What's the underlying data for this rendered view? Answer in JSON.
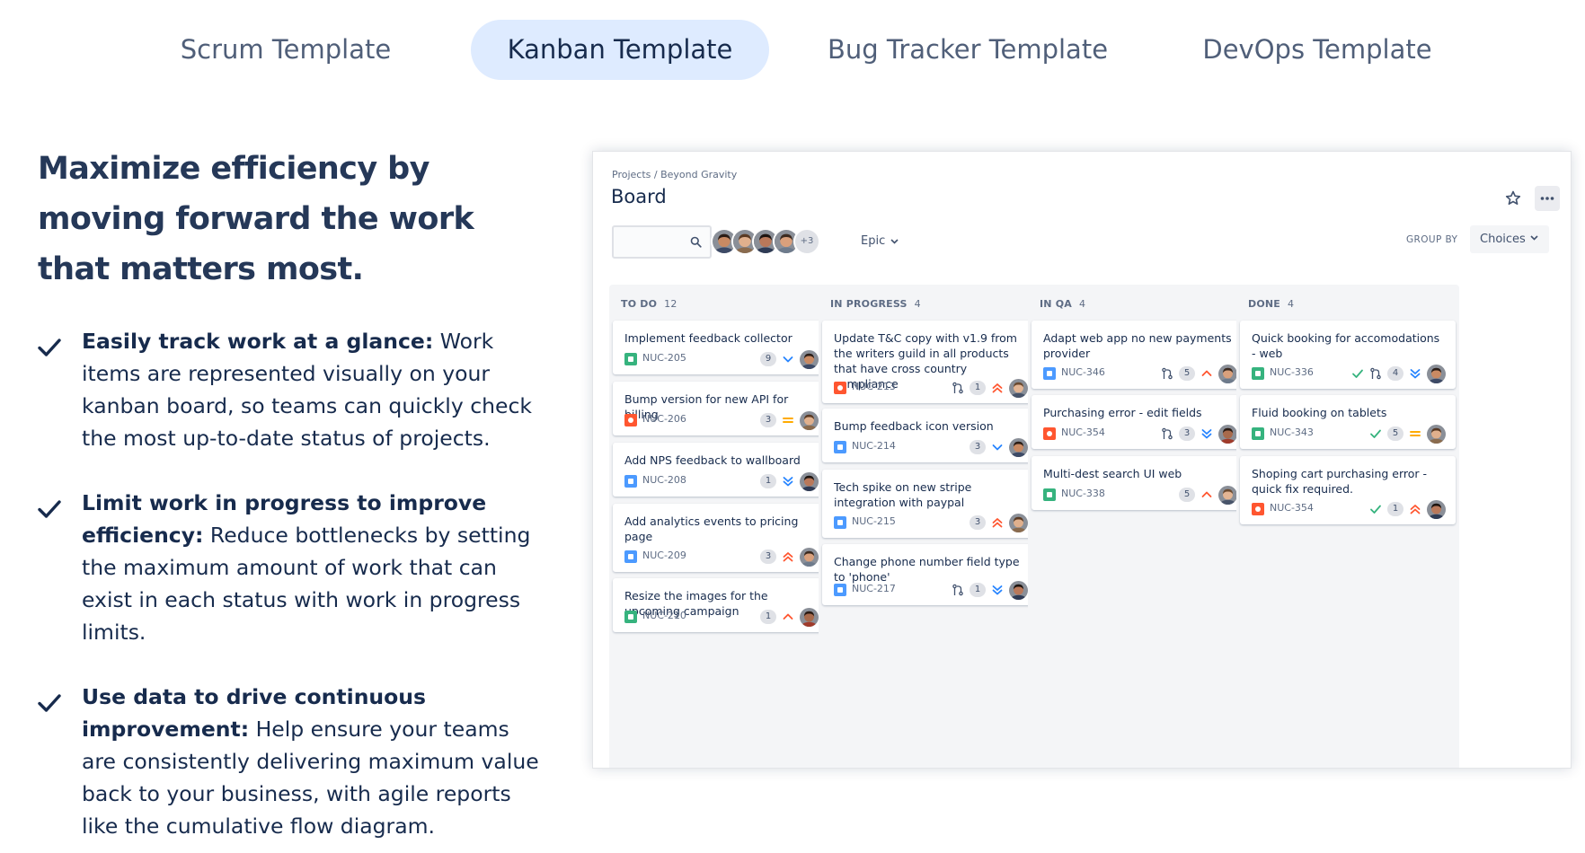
{
  "tabs": [
    {
      "label": "Scrum Template",
      "active": false
    },
    {
      "label": "Kanban Template",
      "active": true
    },
    {
      "label": "Bug Tracker Template",
      "active": false
    },
    {
      "label": "DevOps Template",
      "active": false
    }
  ],
  "heading": "Maximize efficiency by moving forward the work that matters most.",
  "features": [
    {
      "title": "Easily track work at a glance:",
      "text": " Work items are represented visually on your kanban board, so teams can quickly check the most up-to-date status of projects."
    },
    {
      "title": "Limit work in progress to improve efficiency:",
      "text": " Reduce bottlenecks by setting the maximum amount of work that can exist in each status with work in progress limits."
    },
    {
      "title": "Use data to drive continuous improvement:",
      "text": " Help ensure your teams are consistently delivering maximum value back to your business, with agile reports like the cumulative flow diagram."
    }
  ],
  "board": {
    "breadcrumb": "Projects / Beyond Gravity",
    "title": "Board",
    "avatar_more": "+3",
    "epic_label": "Epic",
    "group_by_label": "GROUP BY",
    "group_by_value": "Choices",
    "colors": {
      "accent": "#deebff",
      "column_bg": "#f4f5f7",
      "story": "#36b37e",
      "bug": "#ff5630",
      "task": "#4c9aff"
    },
    "columns": [
      {
        "name": "TO DO",
        "count": "12",
        "cards": [
          {
            "title": "Implement feedback collector",
            "key": "NUC-205",
            "type": "story",
            "points": "9",
            "priority": "low"
          },
          {
            "title": "Bump version for new API for billing",
            "key": "NUC-206",
            "type": "bug",
            "points": "3",
            "priority": "medium"
          },
          {
            "title": "Add NPS feedback to wallboard",
            "key": "NUC-208",
            "type": "task",
            "points": "1",
            "priority": "lowest"
          },
          {
            "title": "Add analytics events to pricing page",
            "key": "NUC-209",
            "type": "task",
            "points": "3",
            "priority": "highest"
          },
          {
            "title": "Resize the images for the upcoming campaign",
            "key": "NUC-210",
            "type": "story",
            "points": "1",
            "priority": "high"
          }
        ]
      },
      {
        "name": "IN PROGRESS",
        "count": "4",
        "cards": [
          {
            "title": "Update T&C copy with v1.9 from the writers guild in all products that have cross country compliance",
            "key": "NUC-213",
            "type": "bug",
            "points": "1",
            "priority": "highest",
            "branch": true
          },
          {
            "title": "Bump feedback icon version",
            "key": "NUC-214",
            "type": "task",
            "points": "3",
            "priority": "low"
          },
          {
            "title": "Tech spike on new stripe integration with paypal",
            "key": "NUC-215",
            "type": "task",
            "points": "3",
            "priority": "highest"
          },
          {
            "title": "Change phone number field type to 'phone'",
            "key": "NUC-217",
            "type": "task",
            "points": "1",
            "priority": "lowest",
            "branch": true
          }
        ]
      },
      {
        "name": "IN QA",
        "count": "4",
        "cards": [
          {
            "title": "Adapt web app no new payments provider",
            "key": "NUC-346",
            "type": "task",
            "points": "5",
            "priority": "high",
            "branch": true
          },
          {
            "title": "Purchasing error - edit fields",
            "key": "NUC-354",
            "type": "bug",
            "points": "3",
            "priority": "lowest",
            "branch": true
          },
          {
            "title": "Multi-dest search UI web",
            "key": "NUC-338",
            "type": "story",
            "points": "5",
            "priority": "high"
          }
        ]
      },
      {
        "name": "DONE",
        "count": "4",
        "cards": [
          {
            "title": "Quick booking for accomodations - web",
            "key": "NUC-336",
            "type": "story",
            "points": "4",
            "priority": "lowest",
            "branch": true,
            "done": true
          },
          {
            "title": "Fluid booking on tablets",
            "key": "NUC-343",
            "type": "story",
            "points": "5",
            "priority": "medium",
            "done": true
          },
          {
            "title": "Shoping cart purchasing error - quick fix required.",
            "key": "NUC-354",
            "type": "bug",
            "points": "1",
            "priority": "highest",
            "done": true
          }
        ]
      }
    ]
  }
}
